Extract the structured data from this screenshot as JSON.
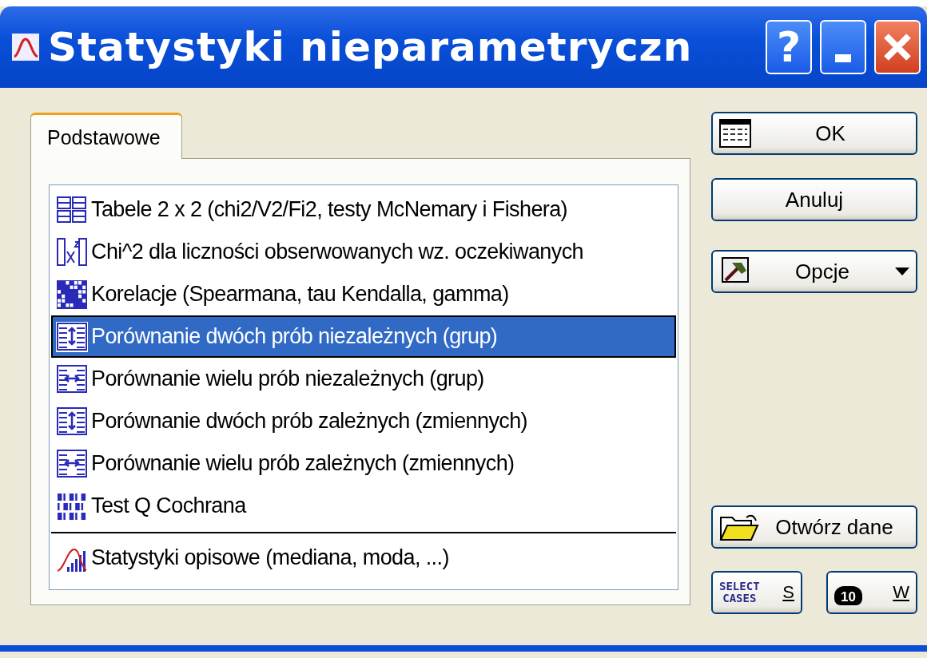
{
  "window": {
    "title": "Statystyki nieparametryczn",
    "title_buttons": [
      "?"
    ]
  },
  "tabs": [
    {
      "label": "Podstawowe",
      "selected": true
    }
  ],
  "list": {
    "items": [
      {
        "label": "Tabele 2 x 2 (chi2/V2/Fi2, testy McNemary i Fishera)",
        "selected": false
      },
      {
        "label": "Chi^2 dla liczności obserwowanych wz. oczekiwanych",
        "selected": false
      },
      {
        "label": "Korelacje (Spearmana, tau Kendalla, gamma)",
        "selected": false
      },
      {
        "label": "Porównanie dwóch prób niezależnych (grup)",
        "selected": true
      },
      {
        "label": "Porównanie wielu prób niezależnych (grup)",
        "selected": false
      },
      {
        "label": "Porównanie dwóch prób zależnych (zmiennych)",
        "selected": false
      },
      {
        "label": "Porównanie wielu prób zależnych (zmiennych)",
        "selected": false
      },
      {
        "label": "Test Q Cochrana",
        "selected": false
      },
      {
        "label": "Statystyki opisowe (mediana, moda, ...)",
        "selected": false
      }
    ]
  },
  "buttons": {
    "ok": "OK",
    "cancel": "Anuluj",
    "options": "Opcje",
    "open_data": "Otwórz dane",
    "select_cases": [
      "SELECT",
      "CASES"
    ],
    "select_cases_key": "S",
    "weight_icon_text": "10",
    "weight_key": "W"
  }
}
